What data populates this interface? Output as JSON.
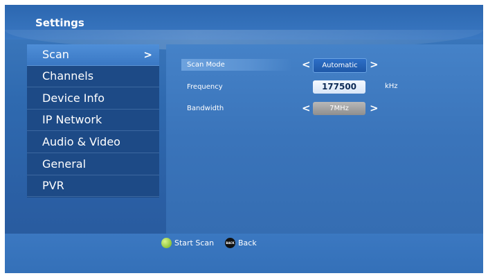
{
  "header": {
    "title": "Settings"
  },
  "menu": {
    "items": [
      {
        "label": "Scan",
        "selected": true
      },
      {
        "label": "Channels"
      },
      {
        "label": "Device Info"
      },
      {
        "label": "IP Network"
      },
      {
        "label": "Audio & Video"
      },
      {
        "label": "General"
      },
      {
        "label": "PVR"
      }
    ],
    "chevron": ">"
  },
  "scan": {
    "scan_mode": {
      "label": "Scan Mode",
      "value": "Automatic"
    },
    "frequency": {
      "label": "Frequency",
      "value": "177500",
      "unit": "kHz"
    },
    "bandwidth": {
      "label": "Bandwidth",
      "value": "7MHz"
    },
    "arrow_left": "<",
    "arrow_right": ">"
  },
  "footer": {
    "start_scan": {
      "label": "Start Scan",
      "color": "#8fc43a"
    },
    "back": {
      "label": "Back",
      "button_text": "BACK"
    }
  },
  "colors": {
    "background": "#2f6ab0",
    "menu_bg": "#1d4a86",
    "selected": "#4f8fd8"
  }
}
